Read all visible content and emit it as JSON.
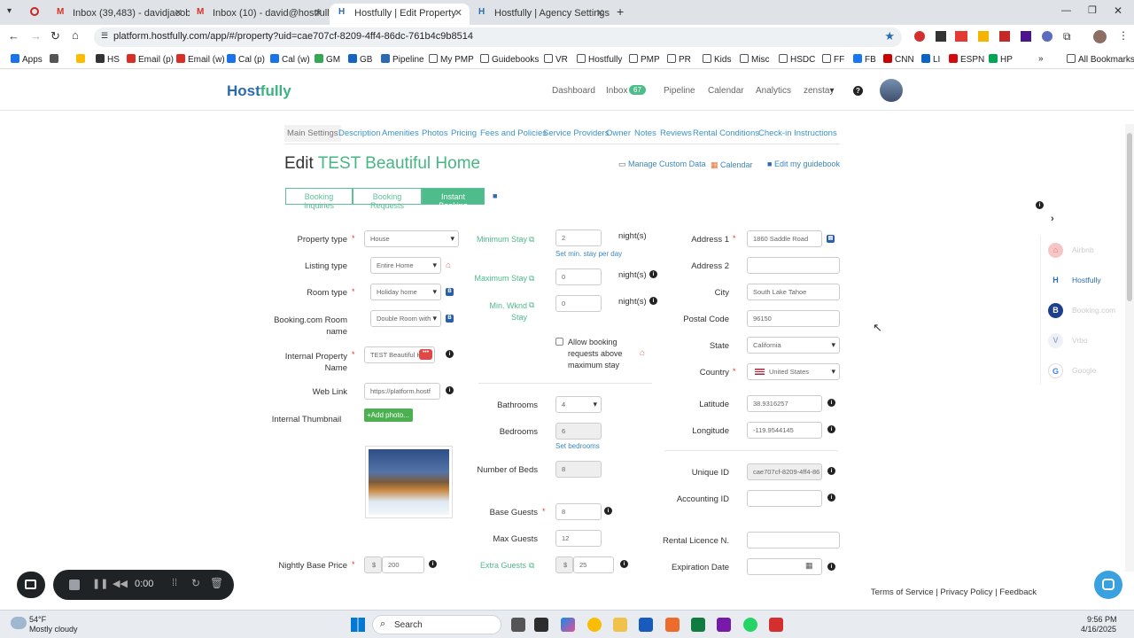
{
  "browser": {
    "tabs": [
      {
        "label": "Inbox (39,483) - davidjacoby@",
        "icon": "gmail-icon"
      },
      {
        "label": "Inbox (10) - david@hostfully.co",
        "icon": "gmail-icon"
      },
      {
        "label": "Hostfully | Edit Property",
        "icon": "hostfully-icon",
        "active": true
      },
      {
        "label": "Hostfully | Agency Settings",
        "icon": "hostfully-icon"
      }
    ],
    "url": "platform.hostfully.com/app/#/property?uid=cae707cf-8209-4ff4-86dc-761b4c9b8514",
    "bookmarks": [
      "Apps",
      "HS",
      "Email (p)",
      "Email (w)",
      "Cal (p)",
      "Cal (w)",
      "GM",
      "GB",
      "Pipeline",
      "My PMP",
      "Guidebooks",
      "VR",
      "Hostfully",
      "PMP",
      "PR",
      "Kids",
      "Misc",
      "HSDC",
      "FF",
      "FB",
      "CNN",
      "LI",
      "ESPN",
      "HP",
      "All Bookmarks"
    ]
  },
  "app": {
    "logo_a": "Host",
    "logo_b": "fully",
    "nav": {
      "dashboard": "Dashboard",
      "inbox": "Inbox",
      "inbox_count": "67",
      "pipeline": "Pipeline",
      "calendar": "Calendar",
      "analytics": "Analytics",
      "account": "zenstay"
    }
  },
  "section_tabs": [
    "Main Settings",
    "Description",
    "Amenities",
    "Photos",
    "Pricing",
    "Fees and Policies",
    "Service Providers",
    "Owner",
    "Notes",
    "Reviews",
    "Rental Conditions",
    "Check-in Instructions"
  ],
  "page": {
    "title_prefix": "Edit",
    "title_name": "TEST Beautiful Home",
    "manage_custom_data": "Manage Custom Data",
    "calendar": "Calendar",
    "edit_guidebook": "Edit my guidebook"
  },
  "booking_buttons": [
    "Booking Inquiries",
    "Booking Requests",
    "Instant Booking"
  ],
  "left": {
    "property_type_label": "Property type",
    "property_type": "House",
    "listing_type_label": "Listing type",
    "listing_type": "Entire Home",
    "room_type_label": "Room type",
    "room_type": "Holiday home",
    "booking_room_label": "Booking.com Room name",
    "booking_room": "Double Room with",
    "internal_name_label": "Internal Property Name",
    "internal_name": "TEST Beautiful H",
    "web_link_label": "Web Link",
    "web_link": "https://platform.hostf",
    "thumbnail_label": "Internal Thumbnail",
    "add_photo": "+Add photo...",
    "nightly_label": "Nightly Base Price",
    "currency": "$",
    "nightly": "200"
  },
  "middle": {
    "min_stay_label": "Minimum Stay",
    "min_stay": "2",
    "set_min": "Set min. stay per day",
    "max_stay_label": "Maximum Stay",
    "max_stay": "0",
    "min_wknd_label": "Min. Wknd Stay",
    "min_wknd": "0",
    "nights": "night(s)",
    "allow_text": "Allow booking requests above maximum stay",
    "bathrooms_label": "Bathrooms",
    "bathrooms": "4",
    "bedrooms_label": "Bedrooms",
    "bedrooms": "6",
    "set_bedrooms": "Set bedrooms",
    "beds_label": "Number of Beds",
    "beds": "8",
    "base_guests_label": "Base Guests",
    "base_guests": "8",
    "max_guests_label": "Max Guests",
    "max_guests": "12",
    "extra_guests_label": "Extra Guests",
    "extra_currency": "$",
    "extra_guests": "25"
  },
  "right": {
    "address1_label": "Address 1",
    "address1": "1860 Saddle Road",
    "address2_label": "Address 2",
    "address2": "",
    "city_label": "City",
    "city": "South Lake Tahoe",
    "postal_label": "Postal Code",
    "postal": "96150",
    "state_label": "State",
    "state": "California",
    "country_label": "Country",
    "country": "United States",
    "lat_label": "Latitude",
    "lat": "38.9316257",
    "lng_label": "Longitude",
    "lng": "-119.9544145",
    "uid_label": "Unique ID",
    "uid": "cae707cf-8209-4ff4-86",
    "acct_label": "Accounting ID",
    "acct": "",
    "licence_label": "Rental Licence N.",
    "licence": "",
    "exp_label": "Expiration Date",
    "exp": ""
  },
  "channels": [
    "Airbnb",
    "Hostfully",
    "Booking.com",
    "Vrbo",
    "Google"
  ],
  "recorder": {
    "time": "0:00"
  },
  "footer": {
    "terms": "Terms of Service",
    "privacy": "Privacy Policy",
    "feedback": "Feedback",
    "sep": "|"
  },
  "taskbar": {
    "temp": "54°F",
    "weather": "Mostly cloudy",
    "search": "Search",
    "time": "9:56 PM",
    "date": "4/16/2025"
  },
  "colors": {
    "brand_blue": "#2a6bb2",
    "brand_green": "#47b585",
    "link": "#3a93c8",
    "required": "#e0363e"
  }
}
